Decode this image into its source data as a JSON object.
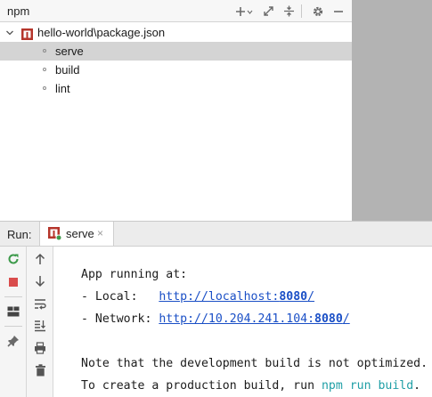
{
  "npm_panel": {
    "title": "npm",
    "root_item": "hello-world\\package.json",
    "scripts": [
      "serve",
      "build",
      "lint"
    ],
    "selected_script": "serve",
    "toolbar_icons": [
      "add-icon",
      "dropdown-arrow-icon",
      "collapse-all-icon",
      "expand-all-icon",
      "gear-icon",
      "minimize-icon"
    ]
  },
  "run_panel": {
    "label": "Run:",
    "tab": {
      "label": "serve",
      "close": "×"
    },
    "left_toolbar_icons": [
      "rerun-icon",
      "stop-icon",
      "layout-icon",
      "pin-icon"
    ],
    "right_toolbar_icons": [
      "scroll-up-icon",
      "scroll-down-icon",
      "soft-wrap-icon",
      "scroll-to-end-icon",
      "print-icon",
      "trash-icon"
    ]
  },
  "console": {
    "line1": "App running at:",
    "local_prefix": "- Local:   ",
    "local_url_base": "http://localhost:",
    "local_port": "8080",
    "local_url_end": "/",
    "network_prefix": "- Network: ",
    "network_url_base": "http://10.204.241.104:",
    "network_port": "8080",
    "network_url_end": "/",
    "note1": "Note that the development build is not optimized.",
    "note2_prefix": "To create a production build, run ",
    "note2_cmd": "npm run build",
    "note2_suffix": "."
  },
  "colors": {
    "selection": "#d4d4d4",
    "link": "#1a4fc6",
    "command": "#1f9fa6",
    "rerun": "#3d9a4b",
    "stop": "#d94c4c",
    "npm_icon": "#b5352b"
  }
}
